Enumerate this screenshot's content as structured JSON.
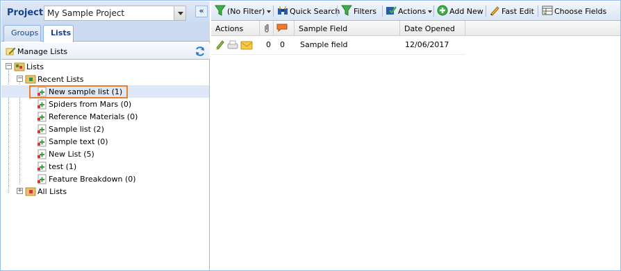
{
  "project": {
    "label": "Project:",
    "value": "My Sample Project",
    "collapse_glyph": "«"
  },
  "tabs": [
    {
      "label": "Groups",
      "active": false
    },
    {
      "label": "Lists",
      "active": true
    }
  ],
  "manage": {
    "label": "Manage Lists",
    "icon": "pencil-icon",
    "refresh_icon": "refresh-icon"
  },
  "tree": {
    "root": "Lists",
    "recent": "Recent Lists",
    "items": [
      "New sample list (1)",
      "Spiders from Mars (0)",
      "Reference Materials (0)",
      "Sample list (2)",
      "Sample text (0)",
      "New List (5)",
      "test (1)",
      "Feature Breakdown (0)"
    ],
    "all": "All Lists",
    "selected_index": 0
  },
  "toolbar": {
    "filter": "(No Filter)",
    "quick_search": "Quick Search",
    "filters": "Filters",
    "actions": "Actions",
    "add_new": "Add New",
    "fast_edit": "Fast Edit",
    "choose_fields": "Choose Fields"
  },
  "grid": {
    "headers": {
      "actions": "Actions",
      "sample_field": "Sample Field",
      "date_opened": "Date Opened"
    },
    "rows": [
      {
        "attachments": "0",
        "comments": "0",
        "sample_field": "Sample field",
        "date_opened": "12/06/2017"
      }
    ]
  },
  "colors": {
    "accent": "#15428b",
    "highlight": "#ee7d24",
    "border": "#99bbe8"
  }
}
